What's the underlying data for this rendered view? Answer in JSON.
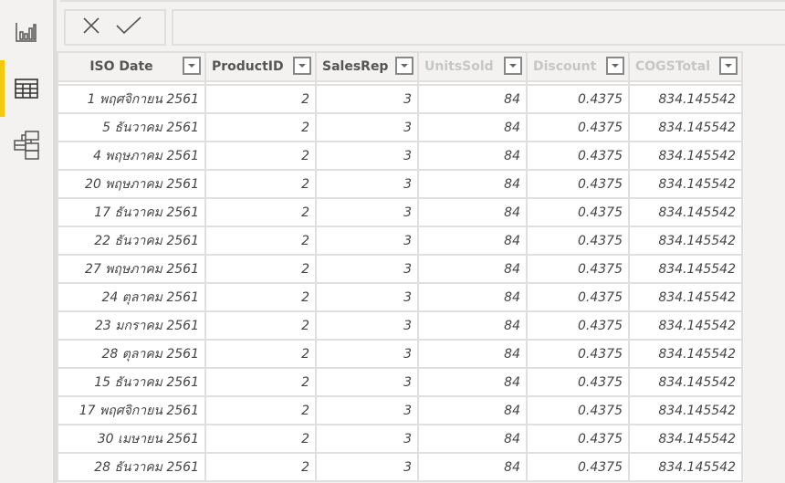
{
  "sidebar": {
    "items": [
      {
        "name": "report-view",
        "icon": "bar-chart-icon",
        "active": false
      },
      {
        "name": "data-view",
        "icon": "table-icon",
        "active": true
      },
      {
        "name": "model-view",
        "icon": "model-icon",
        "active": false
      }
    ]
  },
  "formula_bar": {
    "cancel_icon": "close-icon",
    "commit_icon": "check-icon",
    "value": ""
  },
  "table": {
    "columns": [
      {
        "label": "ISO Date",
        "dim": false
      },
      {
        "label": "ProductID",
        "dim": false
      },
      {
        "label": "SalesRep",
        "dim": false
      },
      {
        "label": "UnitsSold",
        "dim": true
      },
      {
        "label": "Discount",
        "dim": true
      },
      {
        "label": "COGSTotal",
        "dim": true
      }
    ],
    "rows": [
      [
        "1 พฤศจิกายน 2561",
        "2",
        "3",
        "84",
        "0.4375",
        "834.145542"
      ],
      [
        "5 ธันวาคม 2561",
        "2",
        "3",
        "84",
        "0.4375",
        "834.145542"
      ],
      [
        "4 พฤษภาคม 2561",
        "2",
        "3",
        "84",
        "0.4375",
        "834.145542"
      ],
      [
        "20 พฤษภาคม 2561",
        "2",
        "3",
        "84",
        "0.4375",
        "834.145542"
      ],
      [
        "17 ธันวาคม 2561",
        "2",
        "3",
        "84",
        "0.4375",
        "834.145542"
      ],
      [
        "22 ธันวาคม 2561",
        "2",
        "3",
        "84",
        "0.4375",
        "834.145542"
      ],
      [
        "27 พฤษภาคม 2561",
        "2",
        "3",
        "84",
        "0.4375",
        "834.145542"
      ],
      [
        "24 ตุลาคม 2561",
        "2",
        "3",
        "84",
        "0.4375",
        "834.145542"
      ],
      [
        "23 มกราคม 2561",
        "2",
        "3",
        "84",
        "0.4375",
        "834.145542"
      ],
      [
        "28 ตุลาคม 2561",
        "2",
        "3",
        "84",
        "0.4375",
        "834.145542"
      ],
      [
        "15 ธันวาคม 2561",
        "2",
        "3",
        "84",
        "0.4375",
        "834.145542"
      ],
      [
        "17 พฤศจิกายน 2561",
        "2",
        "3",
        "84",
        "0.4375",
        "834.145542"
      ],
      [
        "30 เมษายน 2561",
        "2",
        "3",
        "84",
        "0.4375",
        "834.145542"
      ],
      [
        "28 ธันวาคม 2561",
        "2",
        "3",
        "84",
        "0.4375",
        "834.145542"
      ]
    ]
  }
}
